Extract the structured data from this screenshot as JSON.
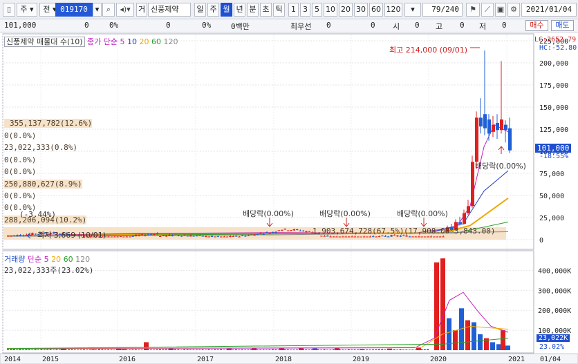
{
  "toolbar": {
    "chart_type": "주",
    "field_type": "전",
    "code": "019170",
    "name": "신풍제약",
    "period_buttons": [
      "일",
      "주",
      "월",
      "년",
      "분",
      "초",
      "틱"
    ],
    "active_period": "월",
    "interval_buttons": [
      "1",
      "3",
      "5",
      "10",
      "20",
      "30",
      "60",
      "120"
    ],
    "page_indicator": "79/240",
    "date": "2021/01/04",
    "prefix_label": "거"
  },
  "quote": {
    "price": "101,000",
    "change": "0",
    "change_pct": "0%",
    "volume": "0",
    "volume_pct": "0%",
    "amount": "0백만",
    "best_bid_label": "최우선",
    "best_bid": "0",
    "best_ask": "0",
    "open_label": "시",
    "open": "0",
    "high_label": "고",
    "high": "0",
    "low_label": "저",
    "low": "0",
    "buy_label": "매수",
    "sell_label": "매도"
  },
  "price_panel": {
    "legend_title": "신풍제약 매물대 수(10)",
    "ma_label": "종가 단순",
    "ma_periods": [
      "5",
      "10",
      "20",
      "60",
      "120"
    ],
    "lc_label": "LC:2652.79",
    "hc_label": "HC:-52.80",
    "volume_profile": [
      "355,137,782(12.6%)",
      "0(0.0%)",
      "23,022,333(0.8%)",
      "0(0.0%)",
      "0(0.0%)",
      "250,880,627(8.9%)",
      "0(0.0%)",
      "0(0.0%)",
      "288,206,094(10.2%)",
      "1,903,674,728(67.5%)"
    ],
    "annotations": {
      "high": "최고 214,000 (09/01)",
      "low": "최저 3,669 (10/01)",
      "low_pct": "(-3.44%)",
      "dividend": "배당락(0.00%)",
      "dividend_2021": "배당락(0.00%)",
      "profile_tail": "(17,908.00~3,843.00)"
    },
    "y_axis_ticks": [
      "225,000",
      "200,000",
      "175,000",
      "150,000",
      "125,000",
      "100,000",
      "75,000",
      "50,000",
      "25,000",
      "0"
    ],
    "current_price_label": "101,000",
    "current_change_label": "-18.55%"
  },
  "volume_panel": {
    "legend_title": "거래량",
    "ma_label": "단순",
    "ma_periods": [
      "5",
      "20",
      "60",
      "120"
    ],
    "current_volume": "23,022,333주(23.02%)",
    "y_axis_ticks": [
      "400,000K",
      "300,000K",
      "200,000K",
      "100,000K"
    ],
    "current_label": "23,022K",
    "current_pct": "23.02%"
  },
  "x_axis": {
    "labels": [
      "2014",
      "2015",
      "2016",
      "2017",
      "2018",
      "2019",
      "2020",
      "2021",
      "01/04"
    ]
  },
  "colors": {
    "up": "#e21f1f",
    "down": "#1f5fd6",
    "ma5": "#c020c0",
    "ma10": "#1f3bc8",
    "ma20": "#f0a800",
    "ma60": "#2aa02a",
    "ma120": "#888888"
  },
  "chart_data": [
    {
      "type": "candlestick",
      "title": "신풍제약 월봉",
      "x": [
        "2014",
        "2015",
        "2016",
        "2017",
        "2018",
        "2019",
        "2020-01",
        "2020-03",
        "2020-05",
        "2020-06",
        "2020-07",
        "2020-08",
        "2020-09",
        "2020-10",
        "2020-11",
        "2020-12",
        "2021-01"
      ],
      "close": [
        4500,
        5500,
        7500,
        7000,
        8200,
        6800,
        7500,
        10000,
        30000,
        55000,
        95000,
        135000,
        120000,
        110000,
        128000,
        124000,
        101000
      ],
      "high_point": {
        "value": 214000,
        "date": "09/01"
      },
      "low_point": {
        "value": 3669,
        "date": "10/01"
      },
      "ylim": [
        0,
        225000
      ]
    },
    {
      "type": "bar",
      "title": "거래량",
      "unit": "K",
      "ylim": [
        0,
        450000
      ],
      "values_highlight": {
        "2020-02": 440000,
        "2020-03": 460000,
        "2021-01": 23022
      }
    }
  ]
}
